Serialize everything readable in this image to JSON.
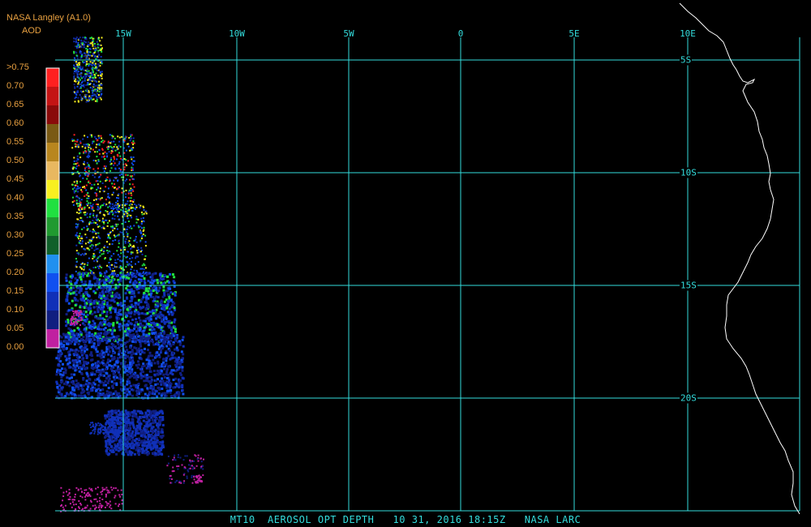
{
  "header": {
    "title": "NASA Langley (A1.0)",
    "subtitle": "AOD"
  },
  "legend": {
    "labels": [
      ">0.75",
      "0.70",
      "0.65",
      "0.60",
      "0.55",
      "0.50",
      "0.45",
      "0.40",
      "0.35",
      "0.30",
      "0.25",
      "0.20",
      "0.15",
      "0.10",
      "0.05",
      "0.00"
    ],
    "colors": [
      "#ff2020",
      "#c41414",
      "#8a0a0a",
      "#7a5a14",
      "#b8861e",
      "#e8b860",
      "#f8f020",
      "#20e040",
      "#209a30",
      "#10602a",
      "#2090f0",
      "#1050f0",
      "#1030b8",
      "#101e80",
      "#c020a0",
      "#c020a0"
    ]
  },
  "grid": {
    "lon_labels": [
      "15W",
      "10W",
      "5W",
      "0",
      "5E",
      "10E"
    ],
    "lat_labels": [
      "5S",
      "10S",
      "15S",
      "20S"
    ],
    "line_color": "#33dddd"
  },
  "footer": "MT10  AEROSOL OPT DEPTH   10 31, 2016 18:15Z   NASA LARC",
  "map": {
    "lon_range": [
      -18,
      15.5
    ],
    "lat_range": [
      -3,
      -25.3
    ],
    "coastline_color": "#ffffff",
    "aerosol_colors": {
      "magenta": "#c020a0",
      "dark_blue": "#101e80",
      "blue": "#1030b8",
      "light_blue": "#1050f0",
      "green": "#20e040",
      "yellow": "#f8f020",
      "red": "#ff2020"
    }
  }
}
